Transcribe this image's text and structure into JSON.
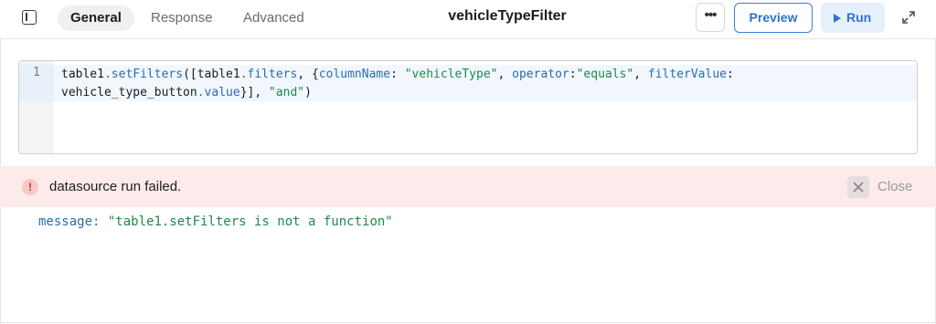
{
  "header": {
    "tabs": [
      {
        "label": "General",
        "active": true
      },
      {
        "label": "Response",
        "active": false
      },
      {
        "label": "Advanced",
        "active": false
      }
    ],
    "title": "vehicleTypeFilter",
    "more_icon": "more-horizontal-icon",
    "preview_label": "Preview",
    "run_label": "Run",
    "accent_color": "#2f73c9"
  },
  "editor": {
    "line_number": "1",
    "code": {
      "t1": "table1",
      "t2": ".setFilters",
      "t3": "([table1",
      "t4": ".filters",
      "t5": ", {",
      "t6": "columnName",
      "t7": ": ",
      "t8": "\"vehicleType\"",
      "t9": ", ",
      "t10": "operator",
      "t11": ":",
      "t12": "\"equals\"",
      "t13": ", ",
      "t14": "filterValue",
      "t15": ":\nvehicle_type_button",
      "t16": ".value",
      "t17": "}], ",
      "t18": "\"and\"",
      "t19": ")"
    }
  },
  "error": {
    "icon_text": "!",
    "text": "datasource run failed.",
    "close_label": "Close",
    "background_color": "#fcebea"
  },
  "message": {
    "key": "message",
    "sep": ": ",
    "value": "\"table1.setFilters is not a function\""
  }
}
